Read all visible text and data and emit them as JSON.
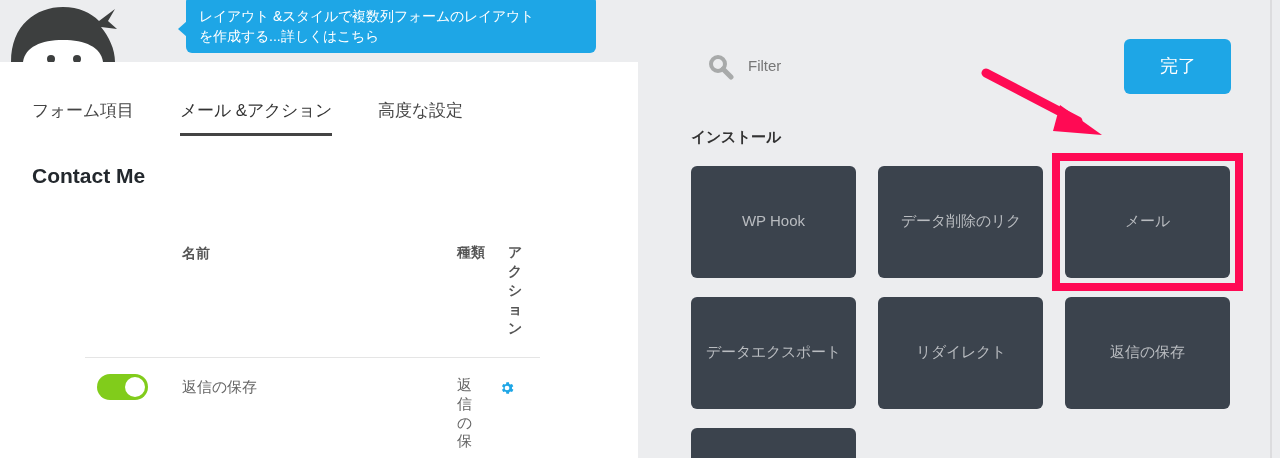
{
  "header": {
    "tooltip": "レイアウト &スタイルで複数列フォームのレイアウトを作成する...詳しくはこちら"
  },
  "tabs": [
    {
      "label": "フォーム項目",
      "selected": false
    },
    {
      "label": "メール &アクション",
      "selected": true
    },
    {
      "label": "高度な設定",
      "selected": false
    }
  ],
  "form_title": "Contact Me",
  "table": {
    "columns": [
      "名前",
      "種類",
      "アクション"
    ],
    "rows": [
      {
        "on": true,
        "name": "返信の保存",
        "type": "返信の保"
      }
    ]
  },
  "filter": {
    "placeholder": "Filter"
  },
  "done_button": "完了",
  "section_title": "インストール",
  "tiles": [
    {
      "label": "WP Hook",
      "highlighted": false
    },
    {
      "label": "データ削除のリク",
      "highlighted": false
    },
    {
      "label": "メール",
      "highlighted": true
    },
    {
      "label": "データエクスポート",
      "highlighted": false
    },
    {
      "label": "リダイレクト",
      "highlighted": false
    },
    {
      "label": "返信の保存",
      "highlighted": false
    },
    {
      "highlighted": false
    }
  ]
}
